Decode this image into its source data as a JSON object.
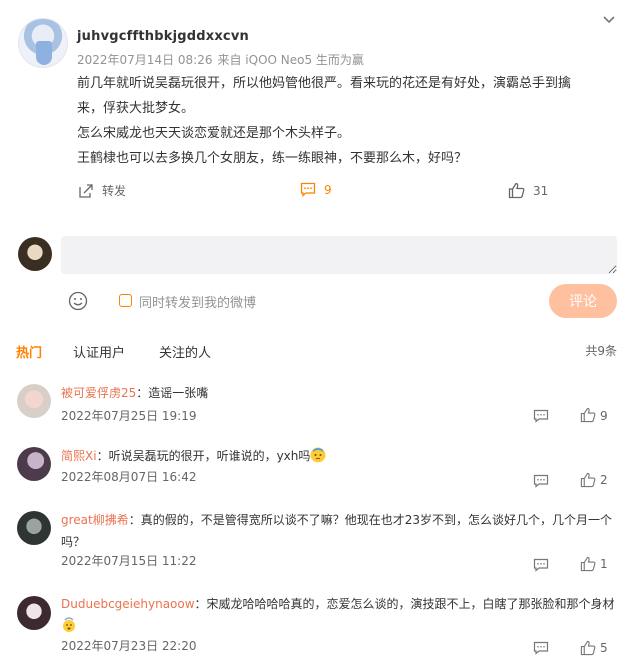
{
  "post": {
    "username": "juhvgcffthbkjgddxxcvn",
    "time": "2022年07月14日 08:26",
    "source": "来自 iQOO Neo5 生而为赢",
    "lines": [
      "前几年就听说吴磊玩很开，所以他妈管他很严。看来玩的花还是有好处，演霸总手到擒",
      "来，俘获大批梦女。",
      "怎么宋威龙也天天谈恋爱就还是那个木头样子。",
      "王鹤棣也可以去多换几个女朋友，练一练眼神，不要那么木，好吗？"
    ],
    "forward_label": "转发",
    "comment_count": "9",
    "like_count": "31"
  },
  "composer": {
    "sync_label": "同时转发到我的微博",
    "submit_label": "评论"
  },
  "tabs": {
    "hot": "热门",
    "verified": "认证用户",
    "following": "关注的人",
    "total": "共9条"
  },
  "comments": [
    {
      "nick": "被可爱俘虏25",
      "text": "：造谣一张嘴",
      "time": "2022年07月25日 19:19",
      "likes": "9"
    },
    {
      "nick": "简熙Xi",
      "text": "：听说吴磊玩的很开，听谁说的，yxh吗",
      "time": "2022年08月07日 16:42",
      "likes": "2"
    },
    {
      "nick": "great柳拂希",
      "text": "：真的假的，不是管得宽所以谈不了嘛？他现在也才23岁不到，怎么谈好几个，几个月一个",
      "text2": "吗？",
      "time": "2022年07月15日 11:22",
      "likes": "1"
    },
    {
      "nick": "Duduebcgeiehynaoow",
      "text": "：宋威龙哈哈哈哈真的，恋爱怎么谈的，演技跟不上，白瞎了那张脸和那个身材",
      "time": "2022年07月23日 22:20",
      "likes": "5"
    }
  ],
  "colors": {
    "accent": "#ff8200",
    "nick": "#eb7350",
    "button": "#ffc09f"
  }
}
